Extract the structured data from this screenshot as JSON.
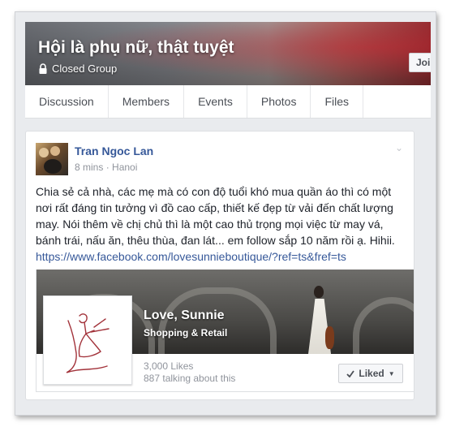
{
  "group": {
    "title": "Hội là phụ nữ, thật tuyệt",
    "privacy_label": "Closed Group",
    "join_label": "Joine"
  },
  "tabs": [
    {
      "label": "Discussion"
    },
    {
      "label": "Members"
    },
    {
      "label": "Events"
    },
    {
      "label": "Photos"
    },
    {
      "label": "Files"
    }
  ],
  "post": {
    "author": "Tran Ngoc Lan",
    "time": "8 mins",
    "separator": "·",
    "location": "Hanoi",
    "text": "Chia sẻ cả nhà, các mẹ mà có con độ tuổi khó mua quần áo thì có một nơi rất đáng tin tưởng vì đồ cao cấp, thiết kế đẹp từ vải đến chất lượng may. Nói thêm về chị chủ thì là một cao thủ trọng mọi việc từ may vá, bánh trái, nấu ăn, thêu thùa, đan lát... em follow sắp 10 năm rồi ạ. Hihii.",
    "link": "https://www.facebook.com/lovesunnieboutique/?ref=ts&fref=ts"
  },
  "page_preview": {
    "name": "Love, Sunnie",
    "category": "Shopping & Retail",
    "likes": "3,000 Likes",
    "talking": "887 talking about this",
    "liked_label": "Liked"
  },
  "icons": {
    "lock": "lock-icon",
    "chevron": "chevron-down-icon",
    "check": "check-icon",
    "caret": "caret-down-icon"
  },
  "colors": {
    "link": "#365899",
    "background": "#e9ebee",
    "meta_text": "#90949c"
  }
}
